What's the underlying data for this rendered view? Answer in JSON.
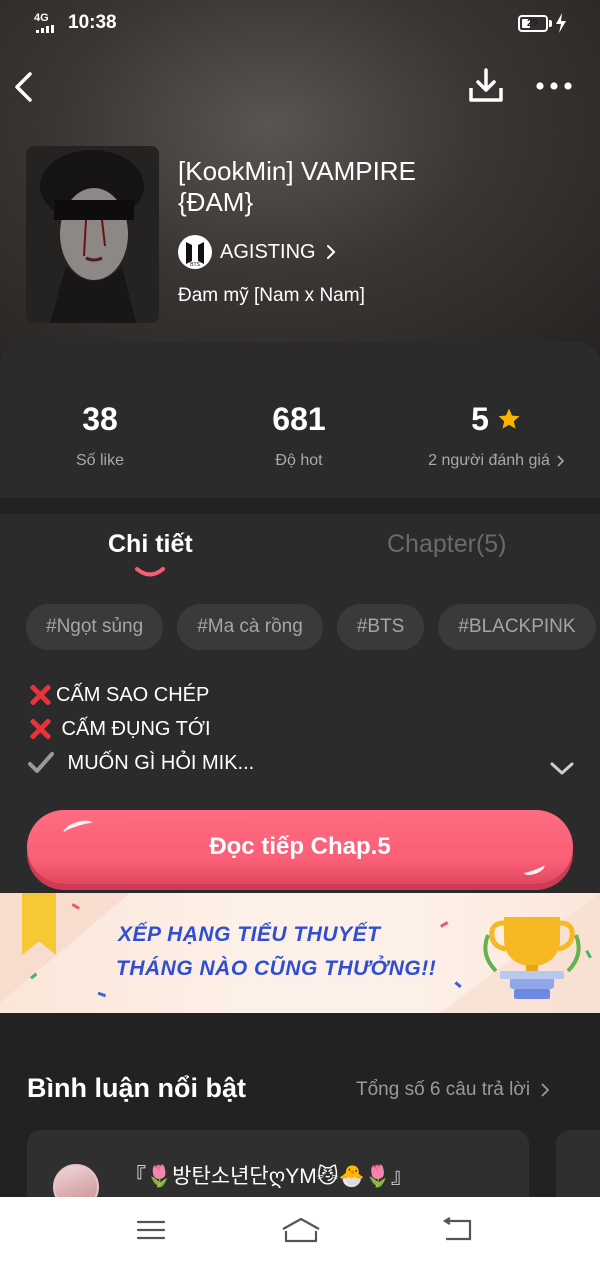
{
  "status_bar": {
    "network": "4G",
    "time": "10:38",
    "battery": "29"
  },
  "header": {
    "back_icon": "chevron-left-icon",
    "download_icon": "download-icon",
    "more_icon": "more-dots-icon"
  },
  "book": {
    "title": "[KookMin] VAMPIRE {ĐAM}",
    "author": "AGISTING",
    "author_badge": "BTS",
    "genre": "Đam mỹ [Nam x Nam]"
  },
  "stats": [
    {
      "value": "38",
      "label": "Số like"
    },
    {
      "value": "681",
      "label": "Độ hot"
    },
    {
      "value": "5",
      "label": "2 người đánh giá"
    }
  ],
  "tabs": [
    {
      "label": "Chi tiết",
      "active": true
    },
    {
      "label": "Chapter(5)",
      "active": false
    }
  ],
  "tags": [
    "#Ngọt sủng",
    "#Ma cà rồng",
    "#BTS",
    "#BLACKPINK"
  ],
  "description": [
    {
      "icon": "red-cross-icon",
      "text": "CẤM SAO CHÉP"
    },
    {
      "icon": "red-cross-icon",
      "text": " CẤM ĐỤNG TỚI"
    },
    {
      "icon": "check-mark-icon",
      "text": " MUỐN GÌ HỎI MIK..."
    }
  ],
  "read_button": {
    "label": "Đọc tiếp Chap.5"
  },
  "banner": {
    "line1": "XẾP HẠNG TIỂU THUYẾT",
    "line2": "THÁNG NÀO CŨNG THƯỞNG!!"
  },
  "comments": {
    "title": "Bình luận nổi bật",
    "total": "Tổng số 6 câu trả lời",
    "first_user": "『🌷방탄소년단ღYM😼🐣🌷』"
  },
  "colors": {
    "accent": "#f95e76",
    "banner_text": "#2f4fd0",
    "star": "#f7b500",
    "background": "#2b2b2b"
  }
}
